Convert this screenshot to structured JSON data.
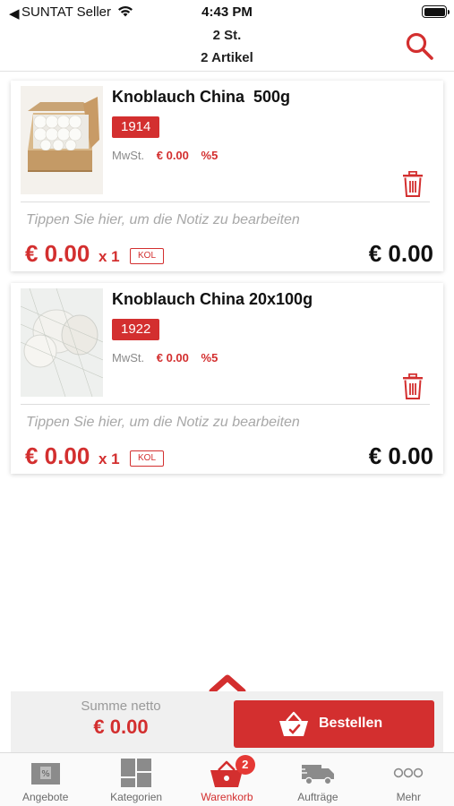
{
  "status_bar": {
    "back_glyph": "◀",
    "carrier": "SUNTAT Seller",
    "time": "4:43 PM"
  },
  "header": {
    "quantity_summary": "2 St.",
    "article_summary": "2 Artikel",
    "search_icon": "search-icon"
  },
  "colors": {
    "accent": "#d32f2f",
    "text": "#111111",
    "muted": "#a8a8a8"
  },
  "cart": {
    "items": [
      {
        "name": "Knoblauch China  500g",
        "sku": "1914",
        "vat_label": "MwSt.",
        "vat_amount": "€ 0.00",
        "vat_rate": "%5",
        "note_placeholder": "Tippen Sie hier, um die Notiz zu bearbeiten",
        "unit_price": "€ 0.00",
        "quantity": "x 1",
        "unit": "KOL",
        "line_total": "€ 0.00",
        "image": "garlic-box-image"
      },
      {
        "name": "Knoblauch China 20x100g",
        "sku": "1922",
        "vat_label": "MwSt.",
        "vat_amount": "€ 0.00",
        "vat_rate": "%5",
        "note_placeholder": "Tippen Sie hier, um die Notiz zu bearbeiten",
        "unit_price": "€ 0.00",
        "quantity": "x 1",
        "unit": "KOL",
        "line_total": "€ 0.00",
        "image": "garlic-net-image"
      }
    ]
  },
  "summary": {
    "label": "Summe netto",
    "total": "€ 0.00",
    "order_button": "Bestellen"
  },
  "tabs": [
    {
      "label": "Angebote",
      "icon": "offers-icon",
      "active": false
    },
    {
      "label": "Kategorien",
      "icon": "categories-icon",
      "active": false
    },
    {
      "label": "Warenkorb",
      "icon": "basket-icon",
      "active": true,
      "badge": "2"
    },
    {
      "label": "Aufträge",
      "icon": "delivery-truck-icon",
      "active": false
    },
    {
      "label": "Mehr",
      "icon": "more-icon",
      "active": false
    }
  ]
}
